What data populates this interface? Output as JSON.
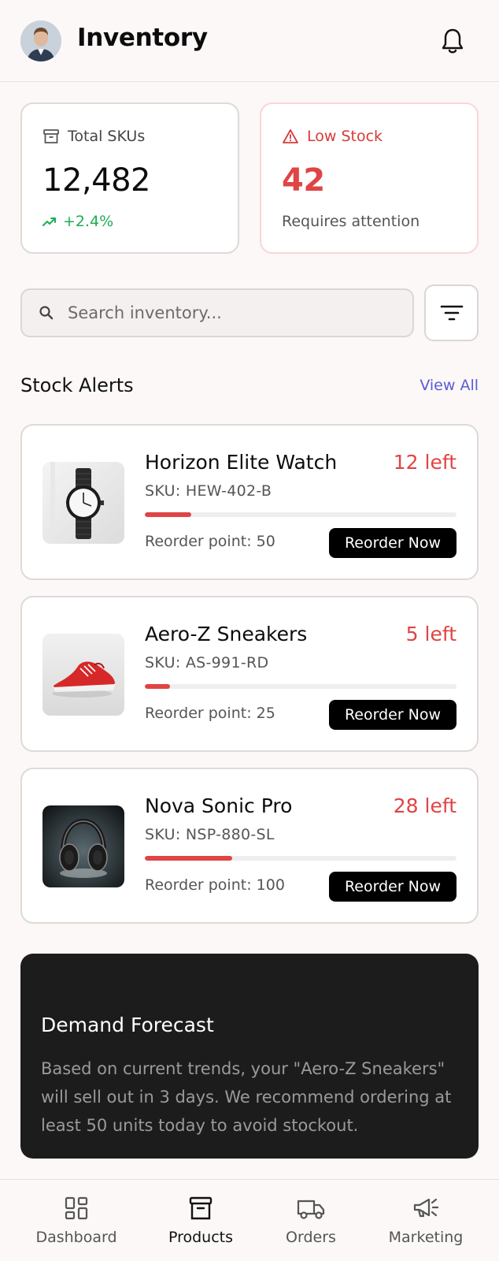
{
  "header": {
    "title": "Inventory",
    "avatar": "user-avatar",
    "notifications_icon": "bell-icon"
  },
  "stats": {
    "total": {
      "icon": "archive-box-icon",
      "label": "Total SKUs",
      "value": "12,482",
      "trend_icon": "trend-up-icon",
      "trend": "+2.4%",
      "trend_color": "#1eae54"
    },
    "low": {
      "icon": "warning-triangle-icon",
      "label": "Low Stock",
      "value": "42",
      "sub": "Requires attention",
      "color": "#e04444"
    }
  },
  "search": {
    "placeholder": "Search inventory...",
    "value": "",
    "icon": "search-icon",
    "filter_icon": "filter-icon"
  },
  "alerts": {
    "title": "Stock Alerts",
    "view_all": "View All",
    "items": [
      {
        "name": "Horizon Elite Watch",
        "left": "12 left",
        "sku": "SKU: HEW-402-B",
        "reorder_point": "Reorder point: 50",
        "level": 0.15,
        "button": "Reorder Now",
        "image": "watch-image"
      },
      {
        "name": "Aero-Z Sneakers",
        "left": "5 left",
        "sku": "SKU: AS-991-RD",
        "reorder_point": "Reorder point: 25",
        "level": 0.08,
        "button": "Reorder Now",
        "image": "sneaker-image"
      },
      {
        "name": "Nova Sonic Pro",
        "left": "28 left",
        "sku": "SKU: NSP-880-SL",
        "reorder_point": "Reorder point: 100",
        "level": 0.28,
        "button": "Reorder Now",
        "image": "headphones-image"
      }
    ]
  },
  "forecast": {
    "title": "Demand Forecast",
    "body": "Based on current trends, your \"Aero-Z Sneakers\" will sell out in 3 days. We recommend ordering at least 50 units today to avoid stockout."
  },
  "tabs": [
    {
      "label": "Dashboard",
      "icon": "dashboard-icon",
      "active": false
    },
    {
      "label": "Products",
      "icon": "archive-box-icon",
      "active": true
    },
    {
      "label": "Orders",
      "icon": "truck-icon",
      "active": false
    },
    {
      "label": "Marketing",
      "icon": "megaphone-icon",
      "active": false
    }
  ],
  "colors": {
    "accent": "#5b5bd6",
    "danger": "#e04444",
    "success": "#1eae54",
    "background": "#fbf8f7"
  }
}
